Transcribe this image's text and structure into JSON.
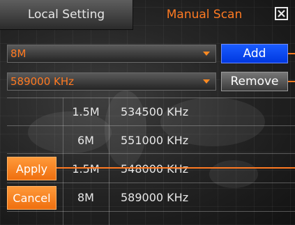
{
  "tabs": [
    {
      "label": "Local Setting",
      "active": false
    },
    {
      "label": "Manual Scan",
      "active": true
    }
  ],
  "close_icon": "close-x-icon",
  "bandwidth_select": {
    "value": "8M"
  },
  "frequency_select": {
    "value": "589000 KHz"
  },
  "buttons": {
    "add": "Add",
    "remove": "Remove",
    "apply": "Apply",
    "cancel": "Cancel"
  },
  "channels": [
    {
      "bandwidth": "1.5M",
      "frequency": "534500 KHz"
    },
    {
      "bandwidth": "6M",
      "frequency": "551000 KHz"
    },
    {
      "bandwidth": "1.5M",
      "frequency": "548000 KHz"
    },
    {
      "bandwidth": "8M",
      "frequency": "589000 KHz"
    }
  ],
  "colors": {
    "accent": "#ff7a22",
    "add_button": "#0038e0",
    "text": "#e8e8e8"
  }
}
